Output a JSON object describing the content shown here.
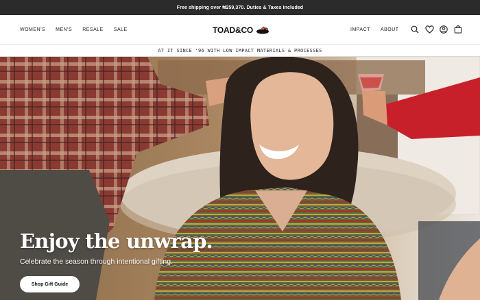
{
  "promo": {
    "text": "Free shipping over ₦259,370. Duties & Taxes included"
  },
  "nav": {
    "left": [
      "WOMEN'S",
      "MEN'S",
      "RESALE",
      "SALE"
    ],
    "right": [
      "IMPACT",
      "ABOUT"
    ]
  },
  "logo": {
    "text": "TOAD&CO"
  },
  "icons": [
    "search-icon",
    "heart-icon",
    "account-icon",
    "bag-icon"
  ],
  "banner": {
    "text": "AT IT SINCE '96 WITH LOW IMPACT MATERIALS & PROCESSES"
  },
  "hero": {
    "title": "Enjoy the unwrap.",
    "subtitle": "Celebrate the season through intentional gifting.",
    "cta": "Shop Gift Guide"
  },
  "colors": {
    "promo_bg": "#2b2b2b",
    "accent_red": "#c8202a"
  }
}
